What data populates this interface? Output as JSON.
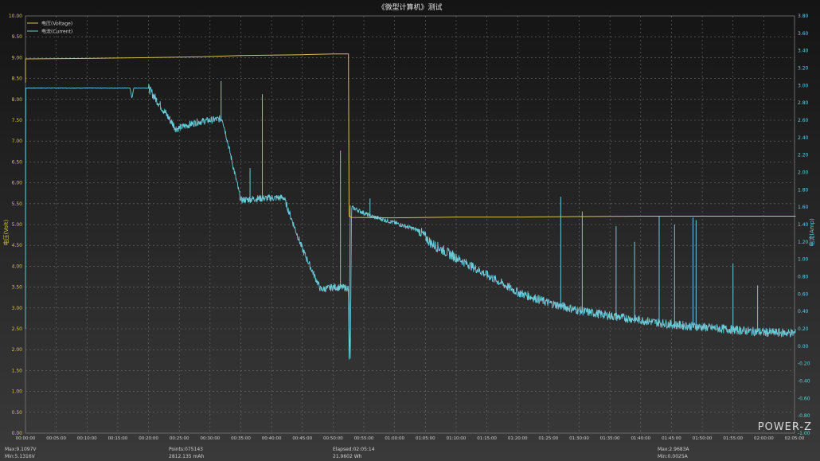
{
  "brand": "POWER-Z",
  "stats": {
    "max_voltage": "Max:9.1097V",
    "min_voltage": "Min:5.1316V",
    "points": "Points:075143",
    "capacity": "2812.135 mAh",
    "elapsed": "Elapsed:02:05:14",
    "energy": "21.9602 Wh",
    "max_current": "Max:2.9683A",
    "min_current": "Min:0.0025A"
  },
  "colors": {
    "voltage": "#d4c24a",
    "current": "#6cc9d8",
    "grid": "#6e6e6e",
    "background_top": "#141414",
    "background_bottom": "#3a3a3a"
  },
  "chart_data": {
    "type": "line",
    "title": "《微型计算机》测试",
    "ylabel": "电压(Volt)",
    "y2label": "电流(Amp)",
    "legend": [
      "电压(Voltage)",
      "电流(Current)"
    ],
    "legend_position": "top-left",
    "grid": true,
    "ylim": [
      0,
      10
    ],
    "y2lim": [
      -1,
      3.8
    ],
    "yticks": [
      "0.00",
      "0.50",
      "1.00",
      "1.50",
      "2.00",
      "2.50",
      "3.00",
      "3.50",
      "4.00",
      "4.50",
      "5.00",
      "5.50",
      "6.00",
      "6.50",
      "7.00",
      "7.50",
      "8.00",
      "8.50",
      "9.00",
      "9.50",
      "10.00"
    ],
    "y2ticks": [
      "-1.00",
      "-0.80",
      "-0.60",
      "-0.40",
      "-0.20",
      "0.00",
      "0.20",
      "0.40",
      "0.60",
      "0.80",
      "1.00",
      "1.20",
      "1.40",
      "1.60",
      "1.80",
      "2.00",
      "2.20",
      "2.40",
      "2.60",
      "2.80",
      "3.00",
      "3.20",
      "3.40",
      "3.60",
      "3.80"
    ],
    "xticks": [
      "00:00:00",
      "00:05:00",
      "00:10:00",
      "00:15:00",
      "00:20:00",
      "00:25:00",
      "00:30:00",
      "00:35:00",
      "00:40:00",
      "00:45:00",
      "00:50:00",
      "00:55:00",
      "01:00:00",
      "01:05:00",
      "01:10:00",
      "01:15:00",
      "01:20:00",
      "01:25:00",
      "01:30:00",
      "01:35:00",
      "01:40:00",
      "01:45:00",
      "01:50:00",
      "01:55:00",
      "02:00:00",
      "02:05:00"
    ],
    "xlim_min": [
      0,
      125
    ],
    "series": [
      {
        "name": "电压(Voltage)",
        "axis": "left",
        "x_min": [
          0,
          10,
          20,
          28,
          35,
          45,
          50,
          52.5,
          52.6,
          53,
          60,
          70,
          80,
          90,
          100,
          110,
          120,
          125.2
        ],
        "values": [
          8.97,
          8.98,
          9.0,
          9.02,
          9.05,
          9.07,
          9.09,
          9.09,
          5.2,
          5.17,
          5.16,
          5.18,
          5.18,
          5.19,
          5.2,
          5.2,
          5.2,
          5.2
        ]
      },
      {
        "name": "电流(Current)",
        "axis": "right",
        "x_min": [
          0,
          17,
          17.3,
          17.6,
          20,
          24.5,
          28,
          32,
          35,
          38,
          42,
          45,
          48,
          50,
          52.5,
          52.8,
          53,
          56,
          60,
          64,
          66,
          70,
          75,
          80,
          85,
          90,
          95,
          100,
          105,
          110,
          115,
          120,
          125.2
        ],
        "values": [
          2.97,
          2.97,
          2.85,
          2.97,
          2.97,
          2.5,
          2.58,
          2.62,
          1.68,
          1.7,
          1.71,
          1.12,
          0.65,
          0.68,
          0.67,
          -0.15,
          1.6,
          1.5,
          1.42,
          1.33,
          1.18,
          1.02,
          0.82,
          0.62,
          0.5,
          0.41,
          0.35,
          0.3,
          0.25,
          0.22,
          0.19,
          0.16,
          0.15
        ]
      }
    ],
    "spikes_current": [
      {
        "x_min": 31.8,
        "value": 3.05
      },
      {
        "x_min": 38.5,
        "value": 2.9
      },
      {
        "x_min": 36.5,
        "value": 2.05
      },
      {
        "x_min": 51.2,
        "value": 2.25
      },
      {
        "x_min": 56,
        "value": 1.7
      },
      {
        "x_min": 87,
        "value": 1.72
      },
      {
        "x_min": 90.5,
        "value": 1.55
      },
      {
        "x_min": 96,
        "value": 1.38
      },
      {
        "x_min": 99,
        "value": 1.2
      },
      {
        "x_min": 103,
        "value": 1.5
      },
      {
        "x_min": 105.5,
        "value": 1.4
      },
      {
        "x_min": 108.5,
        "value": 1.48
      },
      {
        "x_min": 109,
        "value": 1.45
      },
      {
        "x_min": 115,
        "value": 0.95
      },
      {
        "x_min": 119,
        "value": 0.7
      }
    ]
  }
}
